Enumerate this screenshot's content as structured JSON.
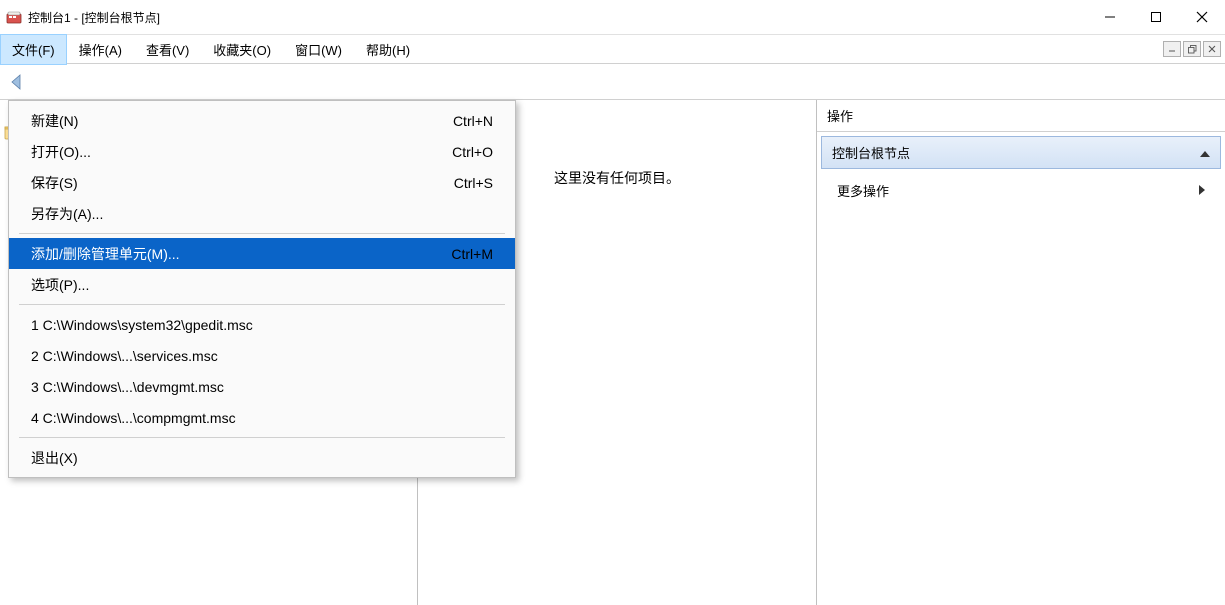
{
  "title": "控制台1 - [控制台根节点]",
  "menubar": {
    "file": "文件(F)",
    "action": "操作(A)",
    "view": "查看(V)",
    "favorites": "收藏夹(O)",
    "window": "窗口(W)",
    "help": "帮助(H)"
  },
  "filemenu": {
    "new": {
      "label": "新建(N)",
      "accel": "Ctrl+N"
    },
    "open": {
      "label": "打开(O)...",
      "accel": "Ctrl+O"
    },
    "save": {
      "label": "保存(S)",
      "accel": "Ctrl+S"
    },
    "saveas": {
      "label": "另存为(A)..."
    },
    "addremove": {
      "label": "添加/删除管理单元(M)...",
      "accel": "Ctrl+M"
    },
    "options": {
      "label": "选项(P)..."
    },
    "recent": [
      "1 C:\\Windows\\system32\\gpedit.msc",
      "2 C:\\Windows\\...\\services.msc",
      "3 C:\\Windows\\...\\devmgmt.msc",
      "4 C:\\Windows\\...\\compmgmt.msc"
    ],
    "exit": {
      "label": "退出(X)"
    }
  },
  "main": {
    "empty": "这里没有任何项目。"
  },
  "actions": {
    "header": "操作",
    "group": "控制台根节点",
    "more": "更多操作"
  }
}
